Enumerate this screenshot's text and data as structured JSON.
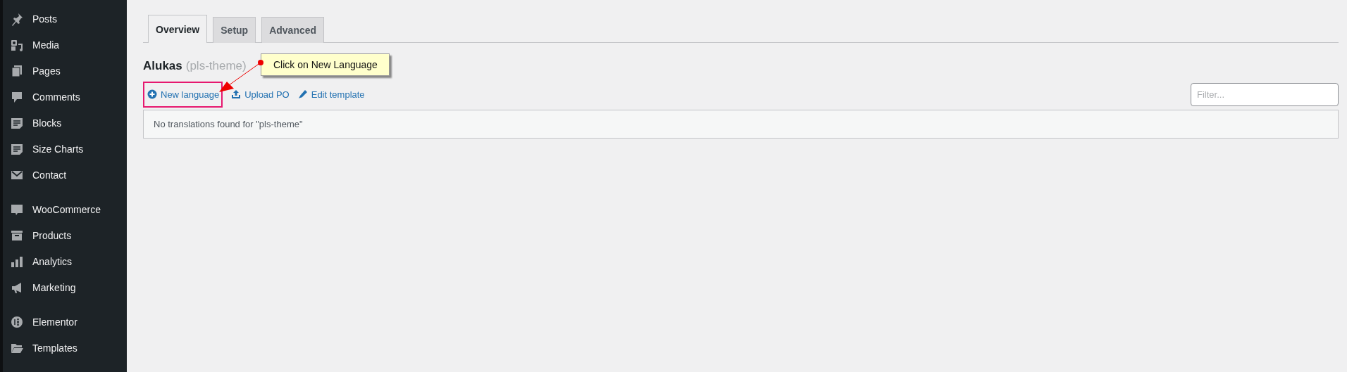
{
  "sidebar": {
    "groups": [
      {
        "items": [
          {
            "label": "Posts"
          },
          {
            "label": "Media"
          },
          {
            "label": "Pages"
          },
          {
            "label": "Comments"
          },
          {
            "label": "Blocks"
          },
          {
            "label": "Size Charts"
          },
          {
            "label": "Contact"
          }
        ]
      },
      {
        "items": [
          {
            "label": "WooCommerce"
          },
          {
            "label": "Products"
          },
          {
            "label": "Analytics"
          },
          {
            "label": "Marketing"
          }
        ]
      },
      {
        "items": [
          {
            "label": "Elementor"
          },
          {
            "label": "Templates"
          }
        ]
      }
    ]
  },
  "tabs": [
    {
      "label": "Overview",
      "selected": true
    },
    {
      "label": "Setup",
      "selected": false
    },
    {
      "label": "Advanced",
      "selected": false
    }
  ],
  "heading": {
    "title": "Alukas",
    "slug": "(pls-theme)"
  },
  "actions": [
    {
      "label": "New language",
      "highlighted": true
    },
    {
      "label": "Upload PO",
      "highlighted": false
    },
    {
      "label": "Edit template",
      "highlighted": false
    }
  ],
  "filter": {
    "placeholder": "Filter..."
  },
  "notice": "No translations found for \"pls-theme\"",
  "callout": {
    "text": "Click on New Language"
  }
}
